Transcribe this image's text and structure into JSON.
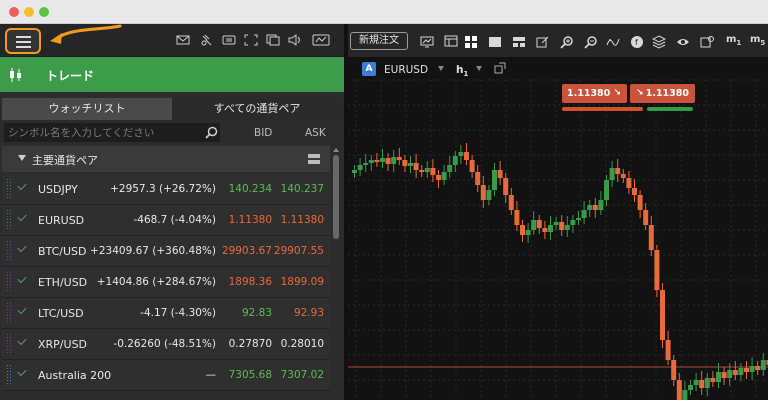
{
  "window": {
    "controls": [
      "close",
      "minimize",
      "zoom"
    ]
  },
  "toolbar": {
    "menu_icon": "hamburger-menu-icon",
    "icons": [
      "mail-icon",
      "alert-icon",
      "news-icon",
      "fullscreen-icon",
      "window-icon",
      "sound-icon",
      "fx-icon"
    ]
  },
  "trade": {
    "title": "トレード",
    "icon": "candlestick-icon",
    "header_color": "#3d9c4a"
  },
  "tabs": {
    "watchlist": "ウォッチリスト",
    "all_pairs": "すべての通貨ペア"
  },
  "search": {
    "placeholder": "シンボル名を入力してください",
    "bid_label": "BID",
    "ask_label": "ASK"
  },
  "group": {
    "label": "主要通貨ペア"
  },
  "colors": {
    "up": "#5bbd4f",
    "down": "#e86a3a",
    "neutral": "#e8e8e8",
    "accent": "#f39a1c"
  },
  "watchlist": [
    {
      "symbol": "USDJPY",
      "change": "+2957.3 (+26.72%)",
      "bid": "140.234",
      "ask": "140.237",
      "dir": "up",
      "handle": "#3c8a45"
    },
    {
      "symbol": "EURUSD",
      "change": "-468.7 (-4.04%)",
      "bid": "1.11380",
      "ask": "1.11380",
      "dir": "down",
      "handle": "#3c8a45"
    },
    {
      "symbol": "BTC/USD",
      "change": "+23409.67 (+360.48%)",
      "bid": "29903.67",
      "ask": "29907.55",
      "dir": "down",
      "handle": "#7b3f99"
    },
    {
      "symbol": "ETH/USD",
      "change": "+1404.86 (+284.67%)",
      "bid": "1898.36",
      "ask": "1899.09",
      "dir": "down",
      "handle": "#7b3f99"
    },
    {
      "symbol": "LTC/USD",
      "change": "-4.17 (-4.30%)",
      "bid": "92.83",
      "ask": "92.93",
      "dir": "mixed",
      "handle": "#7b3f99"
    },
    {
      "symbol": "XRP/USD",
      "change": "-0.26260 (-48.51%)",
      "bid": "0.27870",
      "ask": "0.28010",
      "dir": "neutral",
      "handle": "#7b3f99"
    },
    {
      "symbol": "Australia 200",
      "change": "—",
      "bid": "7305.68",
      "ask": "7307.02",
      "dir": "up",
      "handle": "#3a7fd6"
    }
  ],
  "chart_toolbar": {
    "new_order": "新規注文",
    "icons": [
      "chart-window-icon",
      "layout-icon",
      "grid-icon",
      "single-view-icon",
      "split-view-icon",
      "edit-icon",
      "zoom-in-icon",
      "zoom-out-icon",
      "crosshair-icon",
      "fundamentals-icon",
      "layers-icon",
      "eye-icon",
      "settings-icon",
      "m1-icon",
      "m5-icon"
    ],
    "m1": "m",
    "m1_sub": "1",
    "m5": "m",
    "m5_sub": "5"
  },
  "chart_header": {
    "badge": "A",
    "symbol": "EURUSD",
    "timeframe": "h",
    "timeframe_sub": "1",
    "sell_price": "1.11380",
    "buy_price": "1.11380"
  },
  "chart_data": {
    "type": "candlestick",
    "up_color": "#3a9a4c",
    "down_color": "#e86a3a",
    "horizontal_line_color": "#b7463b"
  }
}
